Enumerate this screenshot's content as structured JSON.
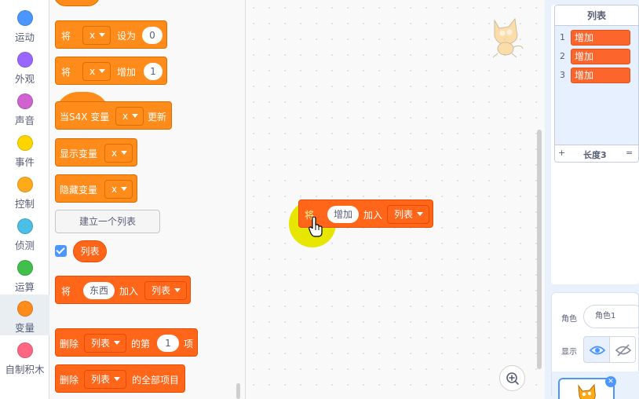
{
  "categories": [
    {
      "label": "运动",
      "color": "#4c97ff",
      "icon": "motion-dot-icon"
    },
    {
      "label": "外观",
      "color": "#9966ff",
      "icon": "looks-dot-icon"
    },
    {
      "label": "声音",
      "color": "#cf63cf",
      "icon": "sound-dot-icon"
    },
    {
      "label": "事件",
      "color": "#ffd500",
      "icon": "events-dot-icon"
    },
    {
      "label": "控制",
      "color": "#ffab19",
      "icon": "control-dot-icon"
    },
    {
      "label": "侦测",
      "color": "#4cbfe6",
      "icon": "sensing-dot-icon"
    },
    {
      "label": "运算",
      "color": "#40bf4a",
      "icon": "operators-dot-icon"
    },
    {
      "label": "变量",
      "color": "#ff8c1a",
      "icon": "variables-dot-icon",
      "selected": true
    },
    {
      "label": "自制积木",
      "color": "#ff6680",
      "icon": "myblocks-dot-icon"
    }
  ],
  "palette": {
    "set_block": {
      "word1": "将",
      "var": "x",
      "word2": "设为",
      "value": "0"
    },
    "change_block": {
      "word1": "将",
      "var": "x",
      "word2": "增加",
      "value": "1"
    },
    "when_var_block": {
      "word1": "当S4X 变量",
      "var": "x",
      "word2": "更新"
    },
    "show_var_block": {
      "word1": "显示变量",
      "var": "x"
    },
    "hide_var_block": {
      "word1": "隐藏变量",
      "var": "x"
    },
    "make_list_button": "建立一个列表",
    "list_reporter": "列表",
    "add_to_list_block": {
      "word1": "将",
      "value": "东西",
      "word2": "加入",
      "list": "列表"
    },
    "delete_of_block": {
      "word1": "删除",
      "list": "列表",
      "word2": "的第",
      "value": "1",
      "word3": "项"
    },
    "delete_all_block": {
      "word1": "删除",
      "list": "列表",
      "word2": "的全部项目"
    }
  },
  "code_area": {
    "dragged_block": {
      "word1": "将",
      "value": "增加",
      "word2": "加入",
      "list": "列表"
    }
  },
  "list_monitor": {
    "title": "列表",
    "items": [
      {
        "index": "1",
        "value": "增加"
      },
      {
        "index": "2",
        "value": "增加"
      },
      {
        "index": "3",
        "value": "增加"
      }
    ],
    "add": "+",
    "length_label": "长度3",
    "resize": "="
  },
  "sprite_info": {
    "sprite_label": "角色",
    "sprite_name": "角色1",
    "show_label": "显示"
  },
  "colors": {
    "variables": "#ff8c1a",
    "lists": "#ff661a",
    "accent": "#4c97ff"
  }
}
